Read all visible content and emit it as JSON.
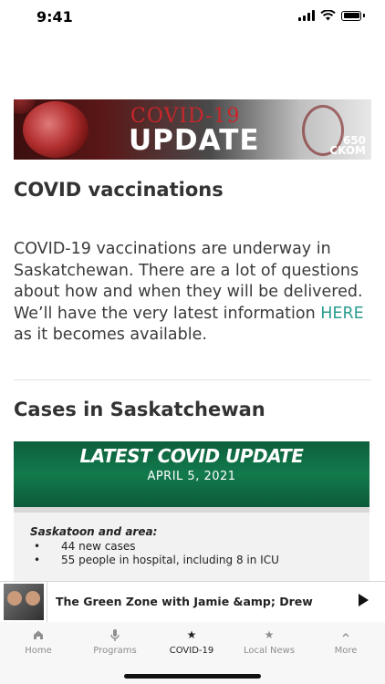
{
  "status_bar": {
    "time": "9:41"
  },
  "banner": {
    "line1": "COVID-19",
    "line2": "UPDATE",
    "station_freq": "650",
    "station_call": "CKOM"
  },
  "article": {
    "headline": "COVID vaccinations",
    "body_before_link": "COVID-19 vaccinations are underway in Saskatchewan. There are a lot of questions about how and when they will be delivered. We’ll have the very latest information ",
    "link_text": "HERE",
    "body_after_link": " as it becomes available.",
    "subheading": "Cases in Saskatchewan"
  },
  "update_image": {
    "title": "LATEST COVID UPDATE",
    "date": "APRIL 5, 2021",
    "region": "Saskatoon and area:",
    "bullets": [
      "44 new cases",
      "55 people in hospital, including 8 in ICU"
    ]
  },
  "player": {
    "title": "The Green Zone with Jamie &amp; Drew",
    "play_icon": "play-icon"
  },
  "tabs": [
    {
      "label": "Home",
      "icon": "home-icon"
    },
    {
      "label": "Programs",
      "icon": "microphone-icon"
    },
    {
      "label": "COVID-19",
      "icon": "star-icon",
      "active": true
    },
    {
      "label": "Local News",
      "icon": "star-icon"
    },
    {
      "label": "More",
      "icon": "chevron-up-icon"
    }
  ],
  "colors": {
    "link": "#2a9d8f",
    "banner_red": "#c9262b",
    "update_green": "#127a4c"
  }
}
